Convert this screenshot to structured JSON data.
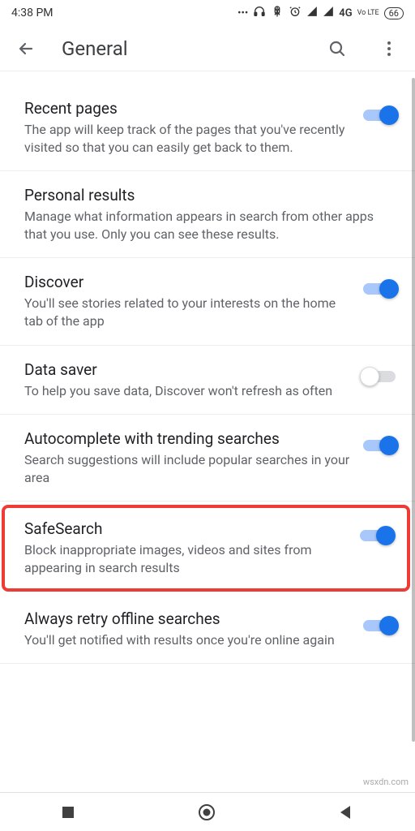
{
  "status": {
    "time": "4:38 PM",
    "battery": "66",
    "network": "4G",
    "volte": "Vo LTE"
  },
  "header": {
    "title": "General"
  },
  "settings": [
    {
      "key": "recent-pages",
      "title": "Recent pages",
      "desc": "The app will keep track of the pages that you've recently visited so that you can easily get back to them.",
      "toggle": true,
      "on": true
    },
    {
      "key": "personal-results",
      "title": "Personal results",
      "desc": "Manage what information appears in search from other apps that you use. Only you can see these results.",
      "toggle": false
    },
    {
      "key": "discover",
      "title": "Discover",
      "desc": "You'll see stories related to your interests on the home tab of the app",
      "toggle": true,
      "on": true
    },
    {
      "key": "data-saver",
      "title": "Data saver",
      "desc": "To help you save data, Discover won't refresh as often",
      "toggle": true,
      "on": false
    },
    {
      "key": "autocomplete",
      "title": "Autocomplete with trending searches",
      "desc": "Search suggestions will include popular searches in your area",
      "toggle": true,
      "on": true
    },
    {
      "key": "safesearch",
      "title": "SafeSearch",
      "desc": "Block inappropriate images, videos and sites from appearing in search results",
      "toggle": true,
      "on": true,
      "highlight": true
    },
    {
      "key": "offline-retry",
      "title": "Always retry offline searches",
      "desc": "You'll get notified with results once you're online again",
      "toggle": true,
      "on": true
    }
  ],
  "watermark": "wsxdn.com"
}
